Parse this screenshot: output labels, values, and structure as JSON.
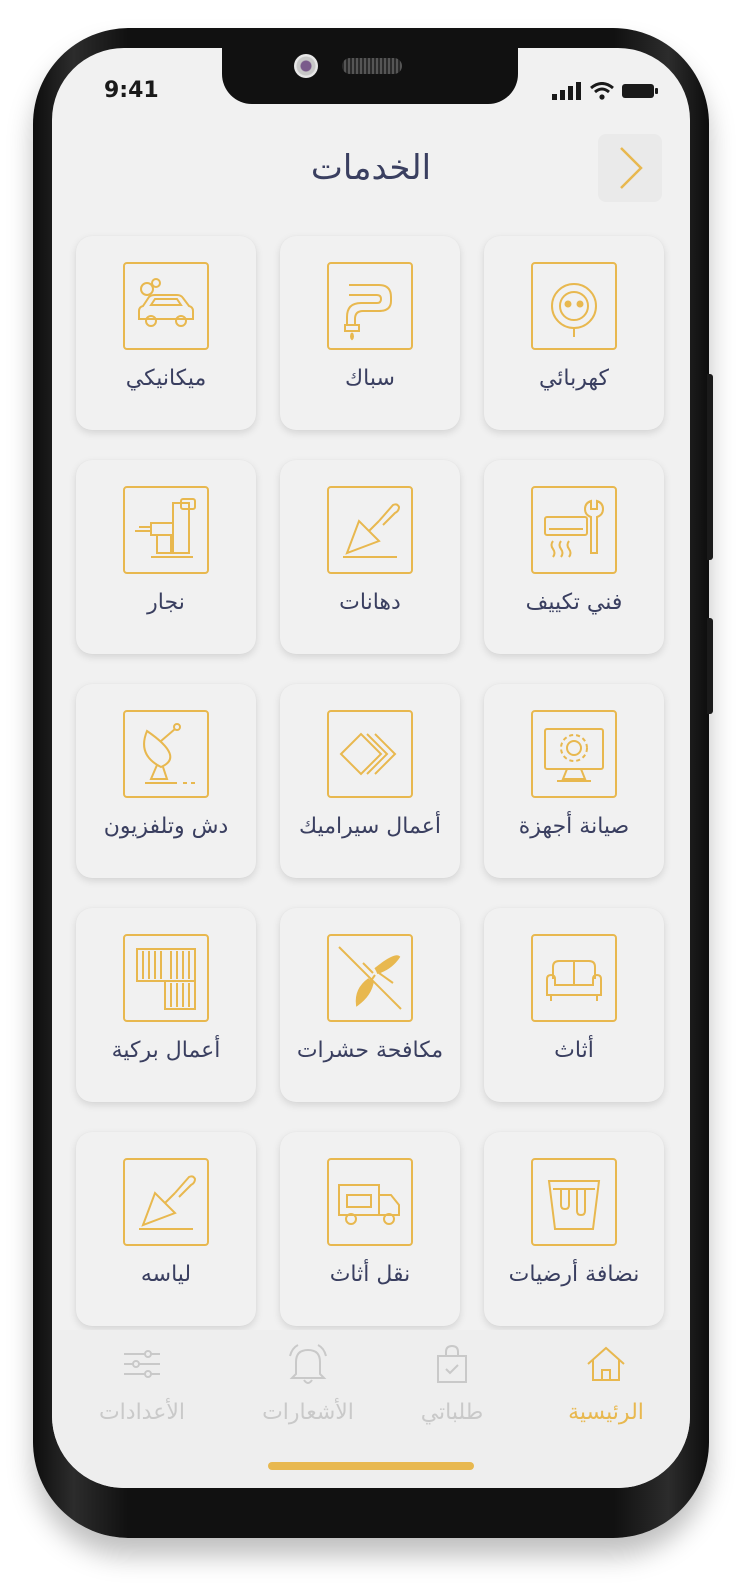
{
  "status_bar": {
    "time": "9:41"
  },
  "header": {
    "title": "الخدمات"
  },
  "services": [
    {
      "label": "كهربائي",
      "icon": "socket-icon"
    },
    {
      "label": "سباك",
      "icon": "pipe-icon"
    },
    {
      "label": "ميكانيكي",
      "icon": "car-icon"
    },
    {
      "label": "فني تكييف",
      "icon": "ac-wrench-icon"
    },
    {
      "label": "دهانات",
      "icon": "trowel-icon"
    },
    {
      "label": "نجار",
      "icon": "drill-icon"
    },
    {
      "label": "صيانة أجهزة",
      "icon": "monitor-gear-icon"
    },
    {
      "label": "أعمال سيراميك",
      "icon": "tiles-icon"
    },
    {
      "label": "دش وتلفزيون",
      "icon": "satellite-dish-icon"
    },
    {
      "label": "أثاث",
      "icon": "sofa-icon"
    },
    {
      "label": "مكافحة حشرات",
      "icon": "mosquito-icon"
    },
    {
      "label": "أعمال بركية",
      "icon": "parquet-icon"
    },
    {
      "label": "نضافة أرضيات",
      "icon": "bucket-icon"
    },
    {
      "label": "نقل أثاث",
      "icon": "truck-icon"
    },
    {
      "label": "لياسه",
      "icon": "plaster-trowel-icon"
    }
  ],
  "tabbar": {
    "items": [
      {
        "label": "الرئيسية",
        "icon": "home-icon",
        "active": true
      },
      {
        "label": "طلباتي",
        "icon": "shopping-bag-icon",
        "active": false
      },
      {
        "label": "الأشعارات",
        "icon": "bell-icon",
        "active": false
      },
      {
        "label": "الأعدادات",
        "icon": "sliders-icon",
        "active": false
      }
    ]
  },
  "colors": {
    "accent": "#e8b84f",
    "text": "#3a3f60",
    "inactive": "#c9c9c9",
    "background": "#f1f1f1"
  }
}
